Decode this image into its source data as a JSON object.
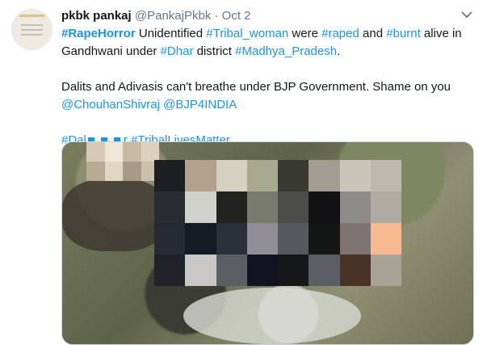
{
  "tweet": {
    "author_name": "pkbk pankaj",
    "handle": "@PankajPkbk",
    "separator": "·",
    "date": "Oct 2",
    "body": [
      {
        "text": "#RapeHorror",
        "type": "tag",
        "bold": true
      },
      {
        "text": " Unidentified ",
        "type": "text"
      },
      {
        "text": "#Tribal_woman",
        "type": "tag"
      },
      {
        "text": " were ",
        "type": "text"
      },
      {
        "text": "#raped",
        "type": "tag"
      },
      {
        "text": " and ",
        "type": "text"
      },
      {
        "text": "#burnt",
        "type": "tag"
      },
      {
        "text": " alive in Gandhwani under ",
        "type": "text"
      },
      {
        "text": "#Dhar",
        "type": "tag"
      },
      {
        "text": " district ",
        "type": "text"
      },
      {
        "text": "#Madhya_Pradesh",
        "type": "tag"
      },
      {
        "text": ".\n\nDalits and Adivasis can't breathe under BJP Government. Shame on you ",
        "type": "text"
      },
      {
        "text": "@ChouhanShivraj",
        "type": "tag"
      },
      {
        "text": " ",
        "type": "text"
      },
      {
        "text": "@BJP4INDIA",
        "type": "tag"
      },
      {
        "text": "\n\n",
        "type": "text"
      },
      {
        "text": "#Dal",
        "type": "tag"
      },
      {
        "type": "censor"
      },
      {
        "text": "r",
        "type": "tag"
      },
      {
        "text": " ",
        "type": "text"
      },
      {
        "text": "#TribalLivesMatter",
        "type": "tag"
      }
    ]
  },
  "icons": {
    "more": "chevron-down-icon",
    "media_censor": "pixelated-censor-icon"
  },
  "colors": {
    "link": "#1b95e0",
    "text": "#14171a",
    "muted": "#657786"
  },
  "media_censor_colors": {
    "small": [
      "#d8c9b4",
      "#efe6da",
      "#c9b9a3",
      "#ddd0be",
      "#b9aa94",
      "#e2d5c1",
      "#a99a85",
      "#cdbfae"
    ],
    "main": [
      "#1e1f22",
      "#b3a18c",
      "#d3d1bf",
      "#a8aa90",
      "#393a32",
      "#a19d92",
      "#c9c5bb",
      "#bdb9b0",
      "#2b2c2f",
      "#d1d1cc",
      "#222220",
      "#797a70",
      "#4d4e4c",
      "#121214",
      "#8d8c8a",
      "#aeaba3",
      "#262a33",
      "#151b25",
      "#29303a",
      "#8f8e96",
      "#545a5b",
      "#151616",
      "#7e7573",
      "#f7b98f",
      "#22232a",
      "#c9c8c6",
      "#5c5e64",
      "#121520",
      "#161718",
      "#5b5e65",
      "#4b3226",
      "#a7a397"
    ]
  }
}
